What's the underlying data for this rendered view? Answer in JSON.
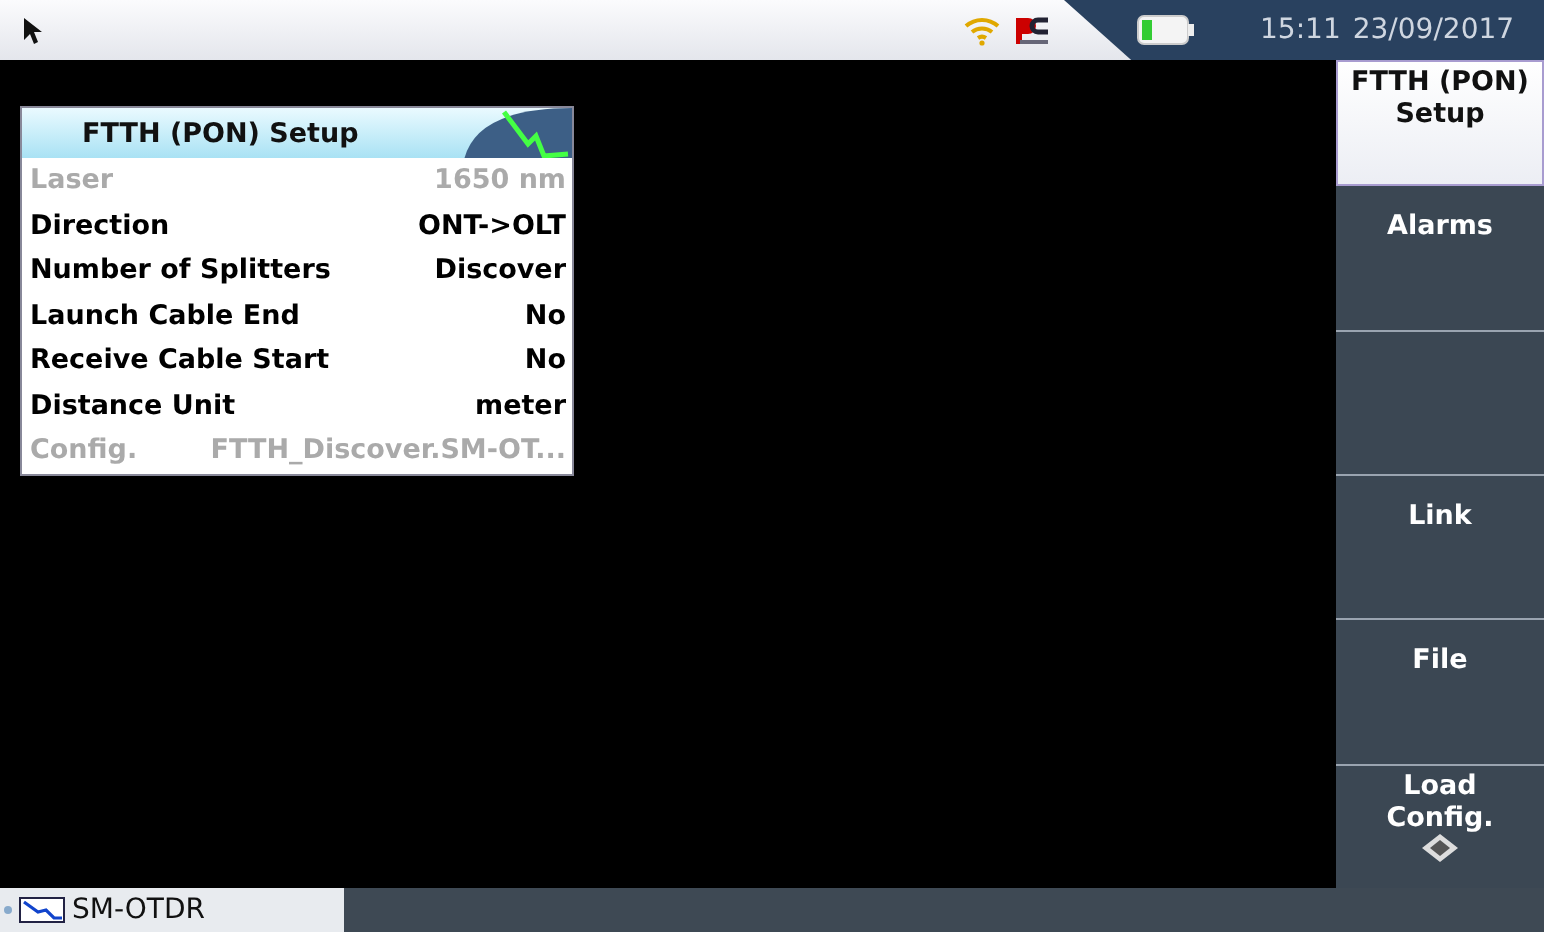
{
  "status_bar": {
    "time": "15:11",
    "date": "23/09/2017"
  },
  "setup_panel": {
    "title": "FTTH (PON) Setup",
    "rows": [
      {
        "label": "Laser",
        "value": "1650 nm",
        "disabled": true
      },
      {
        "label": "Direction",
        "value": "ONT->OLT",
        "disabled": false
      },
      {
        "label": "Number of Splitters",
        "value": "Discover",
        "disabled": false
      },
      {
        "label": "Launch Cable End",
        "value": "No",
        "disabled": false
      },
      {
        "label": "Receive Cable Start",
        "value": "No",
        "disabled": false
      },
      {
        "label": "Distance Unit",
        "value": "meter",
        "disabled": false
      },
      {
        "label": "Config.",
        "value": "FTTH_Discover.SM-OT...",
        "disabled": true
      }
    ]
  },
  "softkeys": [
    {
      "lines": [
        "FTTH (PON)",
        "Setup"
      ],
      "selected": true
    },
    {
      "lines": [
        "Alarms"
      ],
      "selected": false
    },
    {
      "selected": false,
      "kind": "blank"
    },
    {
      "lines": [
        "Link"
      ],
      "selected": false
    },
    {
      "lines": [
        "File"
      ],
      "selected": false
    },
    {
      "lines": [
        "Load",
        "Config."
      ],
      "selected": false,
      "kind": "save"
    }
  ],
  "taskbar": {
    "tab": "SM-OTDR"
  }
}
